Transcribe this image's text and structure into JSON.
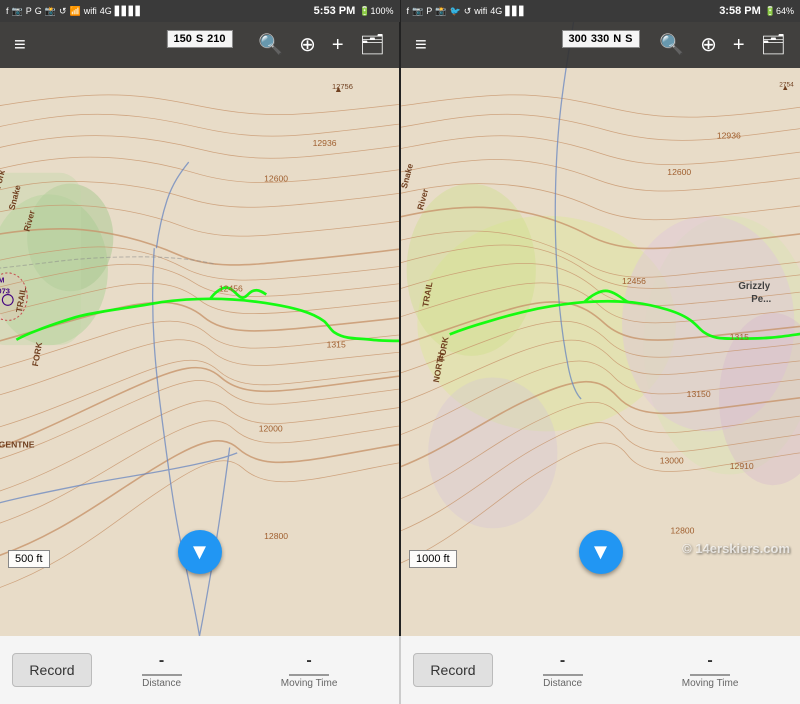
{
  "status_bar_left": {
    "time1": "5:53 PM",
    "battery1": "100%",
    "time2": "3:58 PM",
    "battery2": "64%"
  },
  "panel_left": {
    "toolbar": {
      "menu_icon": "≡",
      "search_icon": "🔍",
      "crosshair_icon": "⊕",
      "add_waypoint_icon": "+",
      "layers_icon": "⊞"
    },
    "compass": {
      "bearing_left": "150",
      "direction": "S",
      "bearing_right": "210"
    },
    "scale": "500 ft",
    "nav_button_icon": "▼"
  },
  "panel_right": {
    "toolbar": {
      "menu_icon": "≡",
      "search_icon": "🔍",
      "crosshair_icon": "⊕",
      "add_waypoint_icon": "+",
      "layers_icon": "⊞"
    },
    "compass": {
      "bearing_left": "300",
      "bearing_mid": "330",
      "direction": "N",
      "bearing_right": "S"
    },
    "scale": "1000 ft",
    "nav_button_icon": "▼"
  },
  "bottom_left": {
    "record_label": "Record",
    "distance_value": "-",
    "distance_label": "Distance",
    "moving_time_value": "-",
    "moving_time_label": "Moving Time"
  },
  "bottom_right": {
    "record_label": "Record",
    "distance_value": "-",
    "distance_label": "Distance",
    "moving_time_value": "-",
    "moving_time_label": "Moving Time"
  },
  "watermark": "© 14erskiers.com"
}
